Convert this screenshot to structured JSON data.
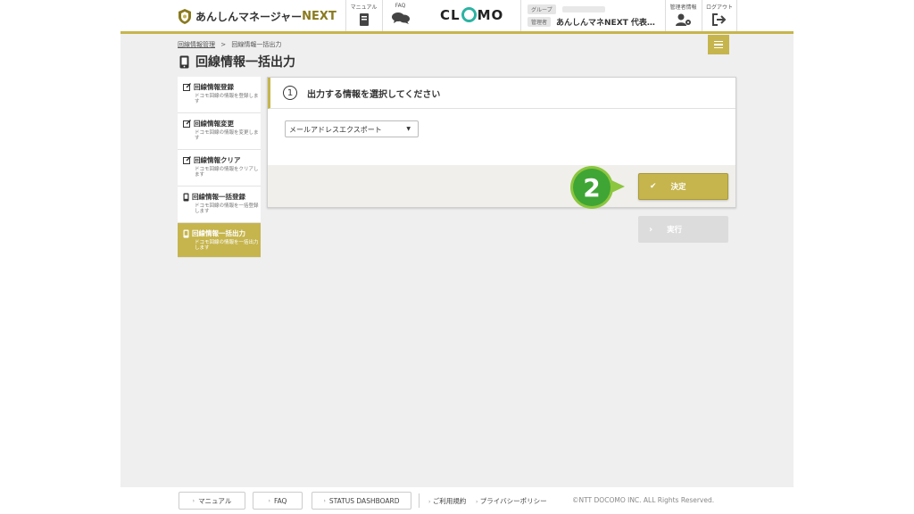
{
  "header": {
    "logo_text": "あんしんマネージャー",
    "logo_next": "NEXT",
    "manual_label": "マニュアル",
    "faq_label": "FAQ",
    "brand": "CLOMO",
    "group_tag": "グループ",
    "admin_tag": "管理者",
    "admin_name": "あんしんマネNEXT 代表…",
    "admin_info_label": "管理者情報",
    "logout_label": "ログアウト",
    "accent_color": "#c6b54d"
  },
  "breadcrumb": {
    "parent": "回線情報管理",
    "separator": ">",
    "current": "回線情報一括出力"
  },
  "page_title": "回線情報一括出力",
  "sidebar": {
    "items": [
      {
        "title": "回線情報登録",
        "desc": "ドコモ回線の情報を登録します",
        "icon": "edit-icon",
        "active": false
      },
      {
        "title": "回線情報変更",
        "desc": "ドコモ回線の情報を変更します",
        "icon": "edit-icon",
        "active": false
      },
      {
        "title": "回線情報クリア",
        "desc": "ドコモ回線の情報をクリアします",
        "icon": "edit-icon",
        "active": false
      },
      {
        "title": "回線情報一括登録",
        "desc": "ドコモ回線の情報を一括登録します",
        "icon": "device-icon",
        "active": false
      },
      {
        "title": "回線情報一括出力",
        "desc": "ドコモ回線の情報を一括出力します",
        "icon": "device-icon",
        "active": true
      }
    ]
  },
  "card": {
    "step_number": "1",
    "title": "出力する情報を選択してください",
    "select_value": "メールアドレスエクスポート",
    "select_arrow": "▼"
  },
  "buttons": {
    "decide": "決定",
    "run": "実行"
  },
  "callout_number": "2",
  "footer": {
    "manual": "マニュアル",
    "faq": "FAQ",
    "status_dashboard": "STATUS DASHBOARD",
    "terms": "ご利用規約",
    "privacy": "プライバシーポリシー",
    "copyright": "©NTT DOCOMO INC. ALL Rights Reserved."
  }
}
